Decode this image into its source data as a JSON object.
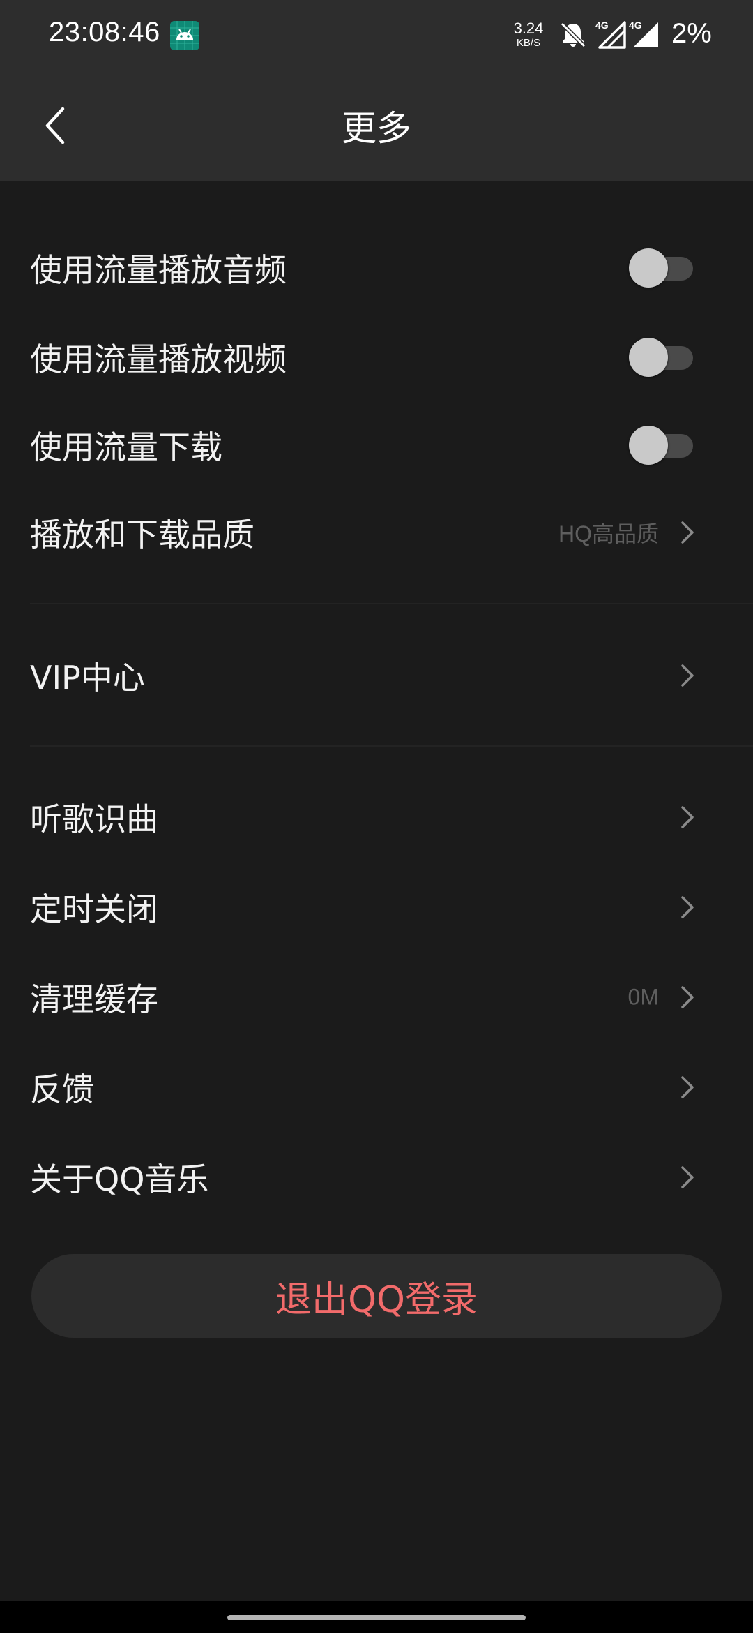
{
  "status_bar": {
    "time": "23:08:46",
    "net_speed_value": "3.24",
    "net_speed_unit": "KB/S",
    "signal_1_label": "4G",
    "signal_2_label": "4G",
    "battery": "2%"
  },
  "header": {
    "title": "更多"
  },
  "settings": {
    "audio_cellular": {
      "label": "使用流量播放音频",
      "enabled": false
    },
    "video_cellular": {
      "label": "使用流量播放视频",
      "enabled": false
    },
    "download_cellular": {
      "label": "使用流量下载",
      "enabled": false
    },
    "quality": {
      "label": "播放和下载品质",
      "value": "HQ高品质"
    }
  },
  "vip": {
    "label": "VIP中心"
  },
  "tools": {
    "song_recognition": {
      "label": "听歌识曲"
    },
    "sleep_timer": {
      "label": "定时关闭"
    },
    "clear_cache": {
      "label": "清理缓存",
      "value": "0M"
    },
    "feedback": {
      "label": "反馈"
    },
    "about": {
      "label": "关于QQ音乐"
    }
  },
  "logout": {
    "label": "退出QQ登录"
  },
  "colors": {
    "background": "#1b1b1b",
    "header": "#2d2d2d",
    "logout_text": "#f26b6b",
    "secondary_text": "#5e5e5e"
  },
  "icons": {
    "back": "chevron-left-icon",
    "row_arrow": "chevron-right-icon",
    "notifications": "bell-off-icon",
    "app": "android-icon"
  }
}
